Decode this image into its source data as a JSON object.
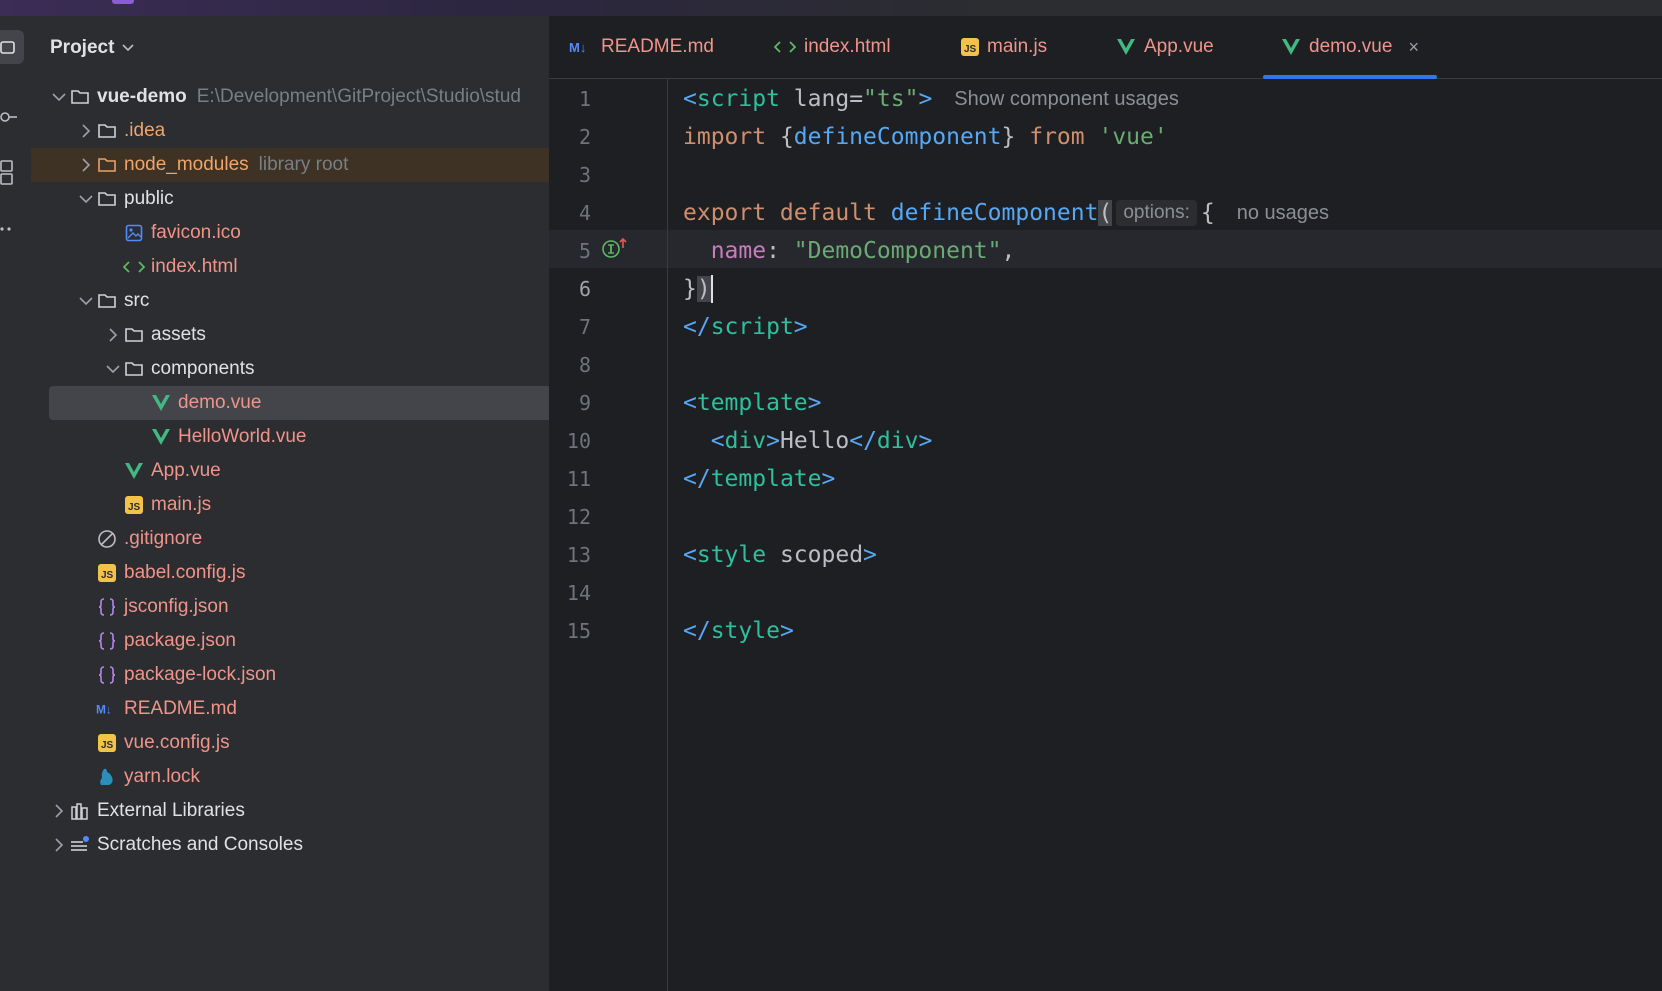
{
  "project_panel": {
    "title": "Project",
    "tree": [
      {
        "label": "vue-demo",
        "hint": "E:\\Development\\GitProject\\Studio\\stud",
        "icon": "folder-icon"
      },
      {
        "label": ".idea",
        "icon": "folder-icon"
      },
      {
        "label": "node_modules",
        "hint": "library root",
        "icon": "folder-icon"
      },
      {
        "label": "public",
        "icon": "folder-icon"
      },
      {
        "label": "favicon.ico",
        "icon": "image-file-icon"
      },
      {
        "label": "index.html",
        "icon": "html-file-icon"
      },
      {
        "label": "src",
        "icon": "folder-icon"
      },
      {
        "label": "assets",
        "icon": "folder-icon"
      },
      {
        "label": "components",
        "icon": "folder-icon"
      },
      {
        "label": "demo.vue",
        "icon": "vue-file-icon"
      },
      {
        "label": "HelloWorld.vue",
        "icon": "vue-file-icon"
      },
      {
        "label": "App.vue",
        "icon": "vue-file-icon"
      },
      {
        "label": "main.js",
        "icon": "js-file-icon"
      },
      {
        "label": ".gitignore",
        "icon": "ignore-file-icon"
      },
      {
        "label": "babel.config.js",
        "icon": "js-file-icon"
      },
      {
        "label": "jsconfig.json",
        "icon": "json-file-icon"
      },
      {
        "label": "package.json",
        "icon": "json-file-icon"
      },
      {
        "label": "package-lock.json",
        "icon": "json-file-icon"
      },
      {
        "label": "README.md",
        "icon": "markdown-file-icon"
      },
      {
        "label": "vue.config.js",
        "icon": "js-file-icon"
      },
      {
        "label": "yarn.lock",
        "icon": "yarn-file-icon"
      },
      {
        "label": "External Libraries",
        "icon": "libraries-icon"
      },
      {
        "label": "Scratches and Consoles",
        "icon": "scratches-icon"
      }
    ]
  },
  "tabs": [
    {
      "label": "README.md",
      "icon": "markdown-file-icon"
    },
    {
      "label": "index.html",
      "icon": "html-file-icon"
    },
    {
      "label": "main.js",
      "icon": "js-file-icon"
    },
    {
      "label": "App.vue",
      "icon": "vue-file-icon"
    },
    {
      "label": "demo.vue",
      "icon": "vue-file-icon",
      "active": true,
      "close": "×"
    }
  ],
  "editor": {
    "line_numbers": [
      "1",
      "2",
      "3",
      "4",
      "5",
      "6",
      "7",
      "8",
      "9",
      "10",
      "11",
      "12",
      "13",
      "14",
      "15"
    ],
    "current_line": "6",
    "lines": {
      "l1": {
        "open": "<",
        "tag": "script",
        "attr": " lang=",
        "val": "\"ts\"",
        "close": ">",
        "inlay": "Show component usages"
      },
      "l2": {
        "kw": "import",
        "brace_open": " {",
        "fn": "defineComponent",
        "brace_close": "} ",
        "kw2": "from",
        "space": " ",
        "str": "'vue'"
      },
      "l4": {
        "kw": "export default",
        "space": " ",
        "fn": "defineComponent",
        "paren": "(",
        "param_hint": "options:",
        "brace": "{",
        "inlay": "no usages"
      },
      "l5": {
        "indent": "  ",
        "prop": "name",
        "colon": ": ",
        "str": "\"DemoComponent\"",
        "comma": ","
      },
      "l6": {
        "brace": "}",
        "paren": ")"
      },
      "l7": {
        "open": "</",
        "tag": "script",
        "close": ">"
      },
      "l9": {
        "open": "<",
        "tag": "template",
        "close": ">"
      },
      "l10": {
        "indent": "  ",
        "open": "<",
        "tag": "div",
        "close": ">",
        "text": "Hello",
        "open2": "</",
        "tag2": "div",
        "close2": ">"
      },
      "l11": {
        "open": "</",
        "tag": "template",
        "close": ">"
      },
      "l13": {
        "open": "<",
        "tag": "style",
        "attr": " scoped",
        "close": ">"
      },
      "l15": {
        "open": "</",
        "tag": "style",
        "close": ">"
      }
    }
  }
}
